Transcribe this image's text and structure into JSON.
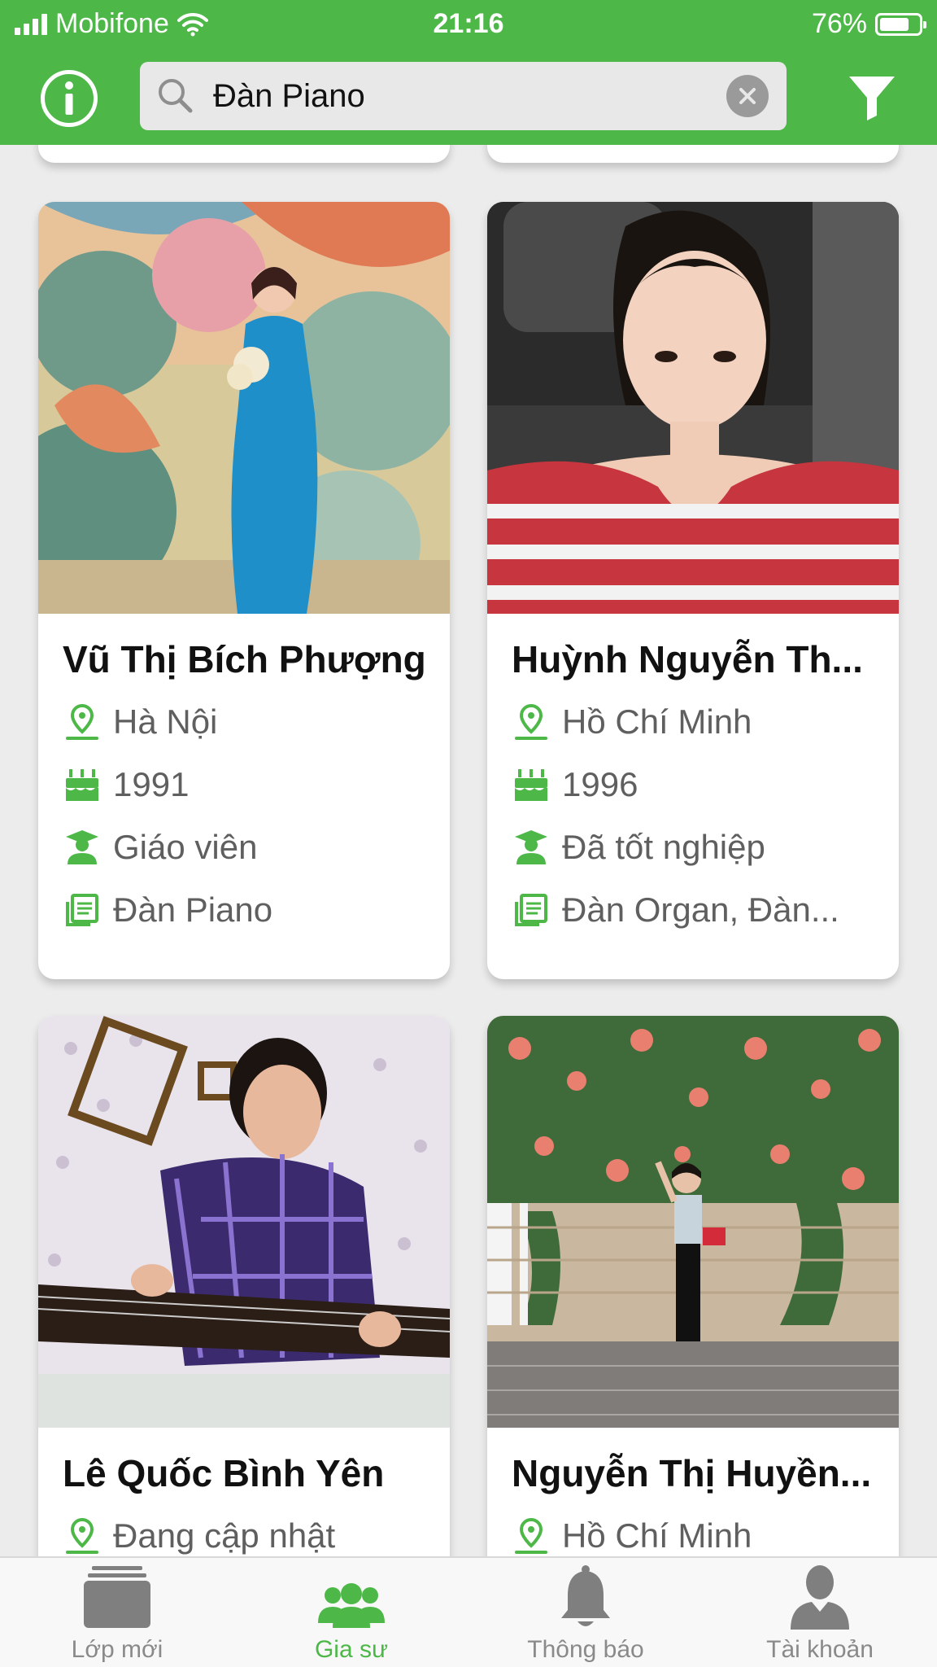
{
  "status_bar": {
    "carrier": "Mobifone",
    "time": "21:16",
    "battery": "76%"
  },
  "header": {
    "search_value": "Đàn Piano"
  },
  "tutors": [
    {
      "name": "Vũ Thị Bích Phượng",
      "location": "Hà Nội",
      "birth_year": "1991",
      "education": "Giáo viên",
      "subjects": "Đàn Piano"
    },
    {
      "name": "Huỳnh Nguyễn Th...",
      "location": "Hồ Chí Minh",
      "birth_year": "1996",
      "education": "Đã tốt nghiệp",
      "subjects": "Đàn Organ, Đàn..."
    },
    {
      "name": "Lê Quốc Bình Yên",
      "location": "Đang cập nhật"
    },
    {
      "name": "Nguyễn Thị Huyền...",
      "location": "Hồ Chí Minh"
    }
  ],
  "tabs": [
    {
      "label": "Lớp mới",
      "icon": "classroom-icon"
    },
    {
      "label": "Gia sư",
      "icon": "tutors-group-icon"
    },
    {
      "label": "Thông báo",
      "icon": "bell-icon"
    },
    {
      "label": "Tài khoản",
      "icon": "person-icon"
    }
  ],
  "colors": {
    "brand_green": "#4db848",
    "inactive_gray": "#8a8a8a",
    "background": "#ececec"
  }
}
